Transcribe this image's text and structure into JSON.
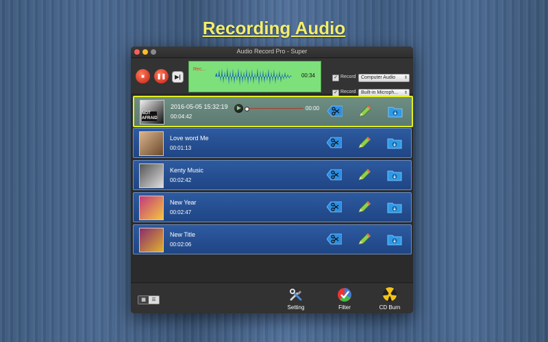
{
  "headline": "Recording Audio",
  "window": {
    "title": "Audio Record Pro - Super"
  },
  "toolbar": {
    "wave_label": "Rec...",
    "wave_time": "00:34",
    "options": [
      {
        "label": "Record",
        "checked": true,
        "value": "Computer Audio"
      },
      {
        "label": "Record",
        "checked": true,
        "value": "Built-in Microph..."
      }
    ]
  },
  "tracks": [
    {
      "name": "2016-05-05 15:32:19",
      "duration": "00:04:42",
      "selected": true,
      "player_time": "00:00",
      "thumb_text": "NOT AFRAID"
    },
    {
      "name": "Love word Me",
      "duration": "00:01:13",
      "selected": false
    },
    {
      "name": "Kenty Music",
      "duration": "00:02:42",
      "selected": false
    },
    {
      "name": "New Year",
      "duration": "00:02:47",
      "selected": false
    },
    {
      "name": "New Title",
      "duration": "00:02:06",
      "selected": false
    }
  ],
  "bottom": {
    "setting_label": "Setting",
    "filter_label": "Filter",
    "cd_label": "CD Burn"
  },
  "colors": {
    "headline": "#f4ef6a",
    "track_bg": "#2d5aa0",
    "selected_border": "#e2f01f",
    "wave_bg": "#7ee07a"
  },
  "icons": [
    "traffic-light-close",
    "traffic-light-minimize",
    "traffic-light-maximize",
    "stop-icon",
    "pause-icon",
    "next-icon",
    "waveform",
    "play-icon",
    "scissors-icon",
    "pencil-icon",
    "save-folder-icon",
    "tools-icon",
    "filter-icon",
    "cd-burn-icon",
    "grid-view-icon",
    "list-view-icon"
  ]
}
